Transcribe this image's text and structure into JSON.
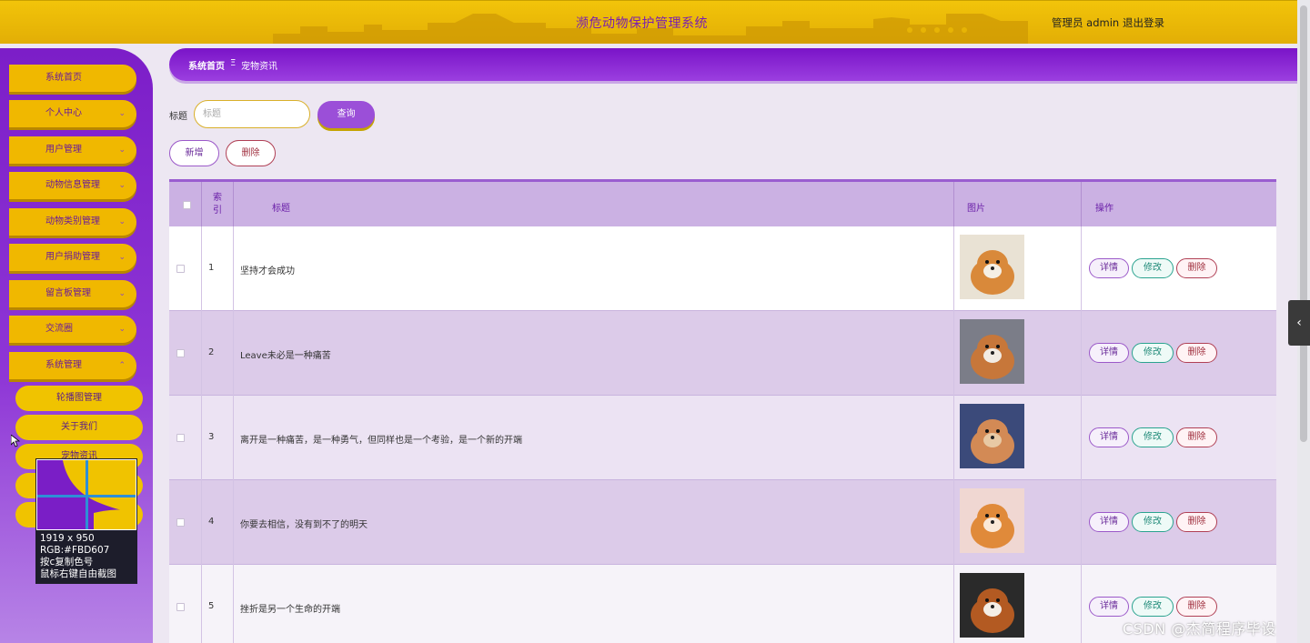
{
  "header": {
    "app_title": "濒危动物保护管理系统",
    "admin_label": "管理员 admin",
    "logout_label": "退出登录"
  },
  "sidebar": {
    "items": [
      {
        "label": "系统首页"
      },
      {
        "label": "个人中心",
        "icon": "chevron-down-icon"
      },
      {
        "label": "用户管理",
        "icon": "chevron-down-icon"
      },
      {
        "label": "动物信息管理",
        "icon": "chevron-down-icon"
      },
      {
        "label": "动物类别管理",
        "icon": "chevron-down-icon"
      },
      {
        "label": "用户捐助管理",
        "icon": "chevron-down-icon"
      },
      {
        "label": "留言板管理",
        "icon": "chevron-down-icon"
      },
      {
        "label": "交流圈",
        "icon": "chevron-down-icon"
      },
      {
        "label": "系统管理",
        "icon": "chevron-up-icon"
      }
    ],
    "sub_items": [
      {
        "label": "轮播图管理"
      },
      {
        "label": "关于我们"
      },
      {
        "label": "宠物资讯"
      },
      {
        "label": ""
      },
      {
        "label": ""
      }
    ]
  },
  "picker": {
    "line1": "1919 x 950",
    "line2": "RGB:#FBD607",
    "line3": "按c复制色号",
    "line4": "鼠标右键自由截图"
  },
  "breadcrumb": {
    "home": "系统首页",
    "separator": "Ξ",
    "current": "宠物资讯"
  },
  "search": {
    "label": "标题",
    "placeholder": "标题",
    "value": "",
    "button": "查询"
  },
  "toolbar": {
    "add_label": "新增",
    "delete_label": "删除"
  },
  "table": {
    "columns": {
      "index": "索引",
      "title": "标题",
      "image": "图片",
      "actions": "操作"
    },
    "action_labels": {
      "detail": "详情",
      "edit": "修改",
      "delete": "删除"
    },
    "rows": [
      {
        "index": "1",
        "title": "坚持才会成功",
        "image": "pomeranian-puppy-photo"
      },
      {
        "index": "2",
        "title": "Leave未必是一种痛苦",
        "image": "corgi-puppy-photo"
      },
      {
        "index": "3",
        "title": "离开是一种痛苦，是一种勇气，但同样也是一个考验，是一个新的开端",
        "image": "two-puppies-photo"
      },
      {
        "index": "4",
        "title": "你要去相信，没有到不了的明天",
        "image": "orange-kitten-photo"
      },
      {
        "index": "5",
        "title": "挫折是另一个生命的开端",
        "image": "spaniel-puppy-photo"
      }
    ]
  },
  "watermark": "CSDN @杰简程序毕设",
  "colors": {
    "header_yellow": "#F2C40A",
    "sidebar_purple": "#7C1EC8",
    "accent_purple": "#9B4FD8",
    "table_header": "#CBB1E3",
    "picker_sample": "#FBD607"
  }
}
